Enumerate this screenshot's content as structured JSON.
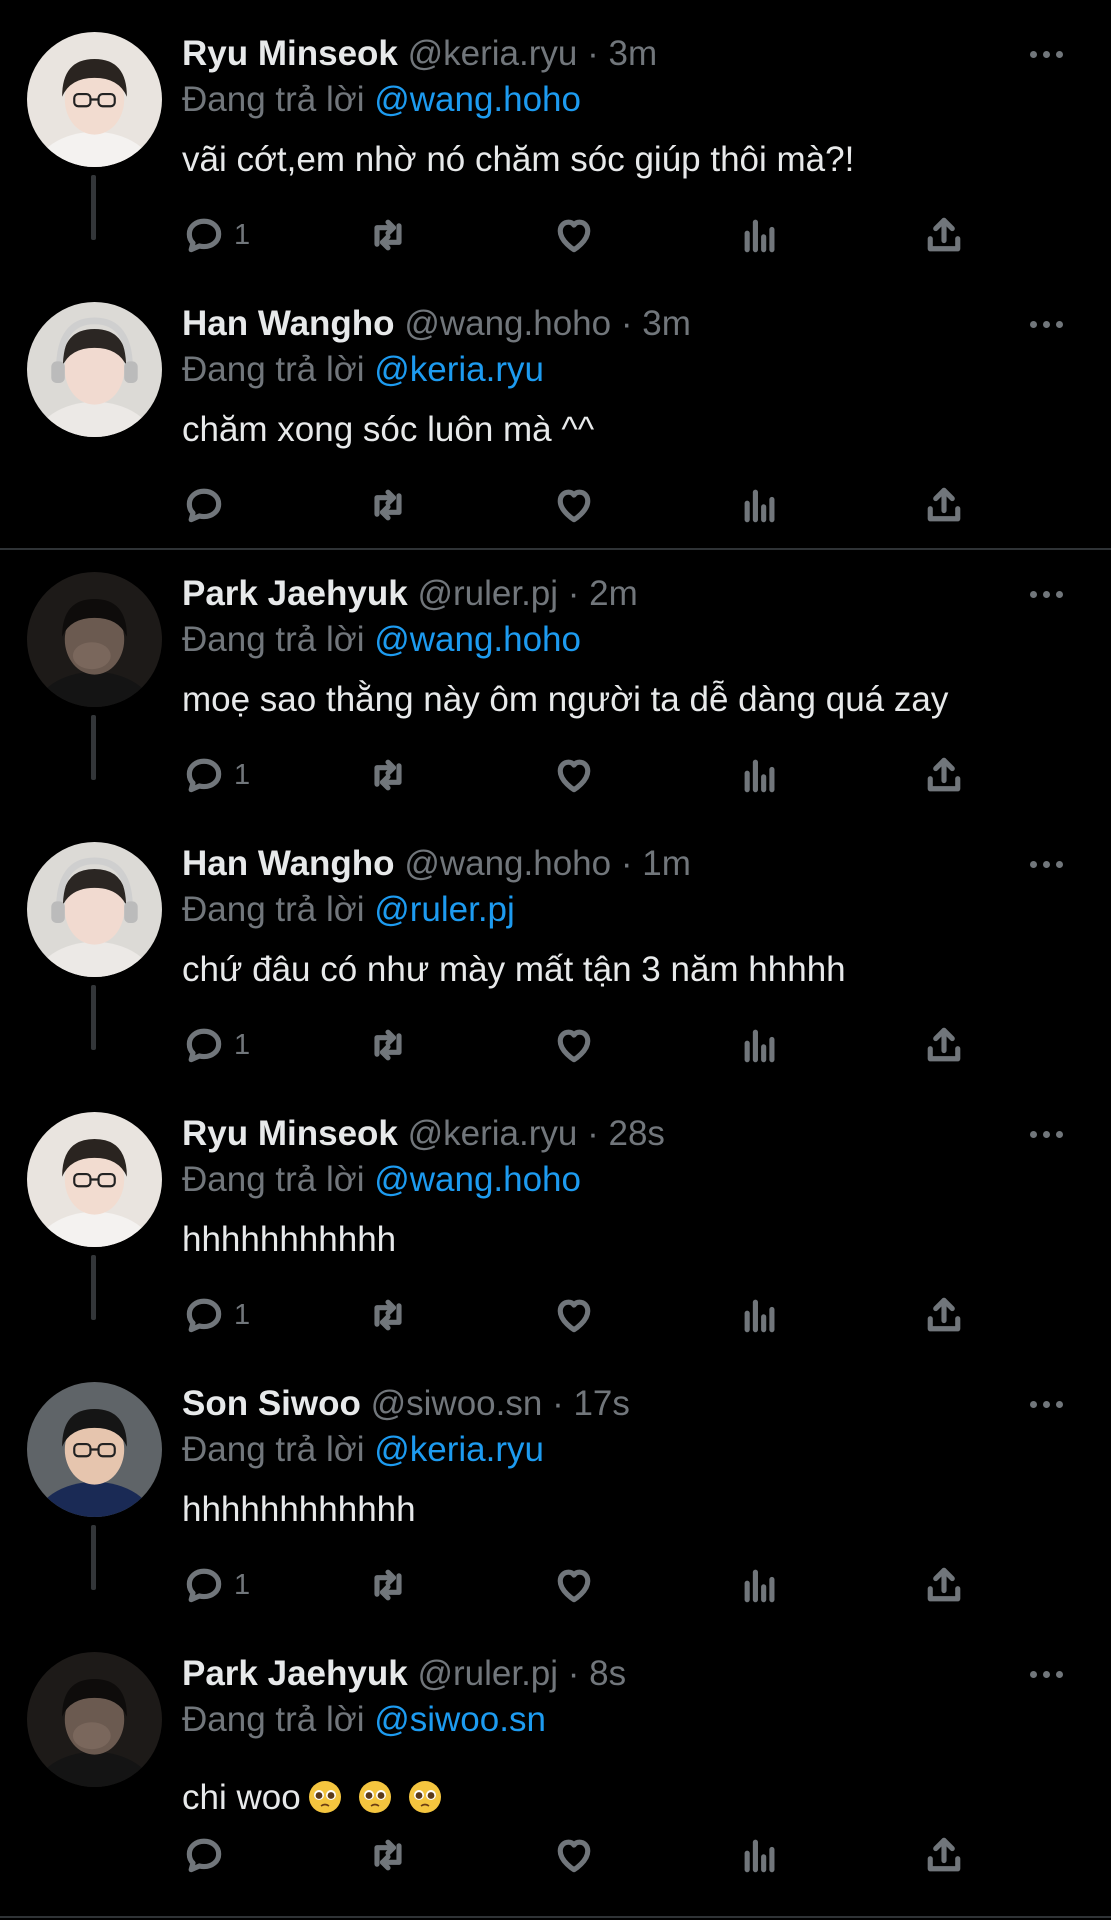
{
  "tweets": [
    {
      "name": "Ryu Minseok",
      "handle": "@keria.ryu",
      "time": "· 3m",
      "replying_prefix": "Đang trả lời",
      "replying_to": "@wang.hoho",
      "text": "vãi cớt,em nhờ nó chăm sóc giúp thôi mà?!",
      "reply_count": "1",
      "avatar": "keria-avatar"
    },
    {
      "name": "Han Wangho",
      "handle": "@wang.hoho",
      "time": "· 3m",
      "replying_prefix": "Đang trả lời",
      "replying_to": "@keria.ryu",
      "text": "chăm xong sóc luôn mà ^^",
      "reply_count": "",
      "avatar": "wangho-avatar"
    },
    {
      "name": "Park Jaehyuk",
      "handle": "@ruler.pj",
      "time": "· 2m",
      "replying_prefix": "Đang trả lời",
      "replying_to": "@wang.hoho",
      "text": "moẹ sao thằng này ôm người ta dễ dàng quá zay",
      "reply_count": "1",
      "avatar": "ruler-avatar"
    },
    {
      "name": "Han Wangho",
      "handle": "@wang.hoho",
      "time": "· 1m",
      "replying_prefix": "Đang trả lời",
      "replying_to": "@ruler.pj",
      "text": "chứ đâu có như mày mất tận 3 năm hhhhh",
      "reply_count": "1",
      "avatar": "wangho-avatar"
    },
    {
      "name": "Ryu Minseok",
      "handle": "@keria.ryu",
      "time": "· 28s",
      "replying_prefix": "Đang trả lời",
      "replying_to": "@wang.hoho",
      "text": "hhhhhhhhhhh",
      "reply_count": "1",
      "avatar": "keria-avatar"
    },
    {
      "name": "Son Siwoo",
      "handle": "@siwoo.sn",
      "time": "· 17s",
      "replying_prefix": "Đang trả lời",
      "replying_to": "@keria.ryu",
      "text": "hhhhhhhhhhhh",
      "reply_count": "1",
      "avatar": "siwoo-avatar"
    },
    {
      "name": "Park Jaehyuk",
      "handle": "@ruler.pj",
      "time": "· 8s",
      "replying_prefix": "Đang trả lời",
      "replying_to": "@siwoo.sn",
      "text": "chi woo",
      "reply_count": "",
      "avatar": "ruler-avatar"
    }
  ],
  "icons": {
    "reply": "reply-icon",
    "retweet": "retweet-icon",
    "like": "heart-icon",
    "views": "views-icon",
    "share": "share-icon",
    "more": "more-icon",
    "emoji": "pleading-face-emoji"
  },
  "colors": {
    "background": "#000000",
    "mention": "#1d9bf0",
    "muted": "#71767b",
    "text": "#e7e9ea"
  }
}
